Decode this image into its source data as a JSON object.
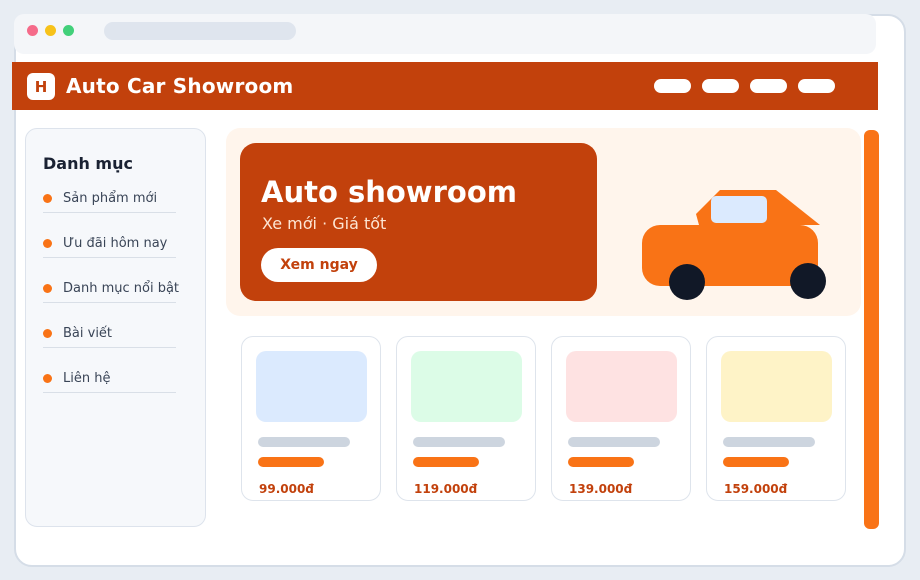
{
  "header": {
    "logo_letter": "H",
    "title": "Auto Car Showroom",
    "nav_items": 4
  },
  "sidebar": {
    "title": "Danh mục",
    "items": [
      {
        "label": "Sản phẩm mới"
      },
      {
        "label": "Ưu đãi hôm nay"
      },
      {
        "label": "Danh mục nổi bật"
      },
      {
        "label": "Bài viết"
      },
      {
        "label": "Liên hệ"
      }
    ]
  },
  "hero": {
    "title": "Auto showroom",
    "subtitle": "Xe mới · Giá tốt",
    "button_label": "Xem ngay",
    "image": "car-illustration"
  },
  "products": [
    {
      "price": "99.000đ",
      "thumb_color": "#dbeafe"
    },
    {
      "price": "119.000đ",
      "thumb_color": "#dcfce7"
    },
    {
      "price": "139.000đ",
      "thumb_color": "#fee2e2"
    },
    {
      "price": "159.000đ",
      "thumb_color": "#fef3c7"
    }
  ],
  "colors": {
    "brand": "#c2410c",
    "accent": "#f97316",
    "car_body": "#f97316",
    "car_wheel": "#111827"
  }
}
